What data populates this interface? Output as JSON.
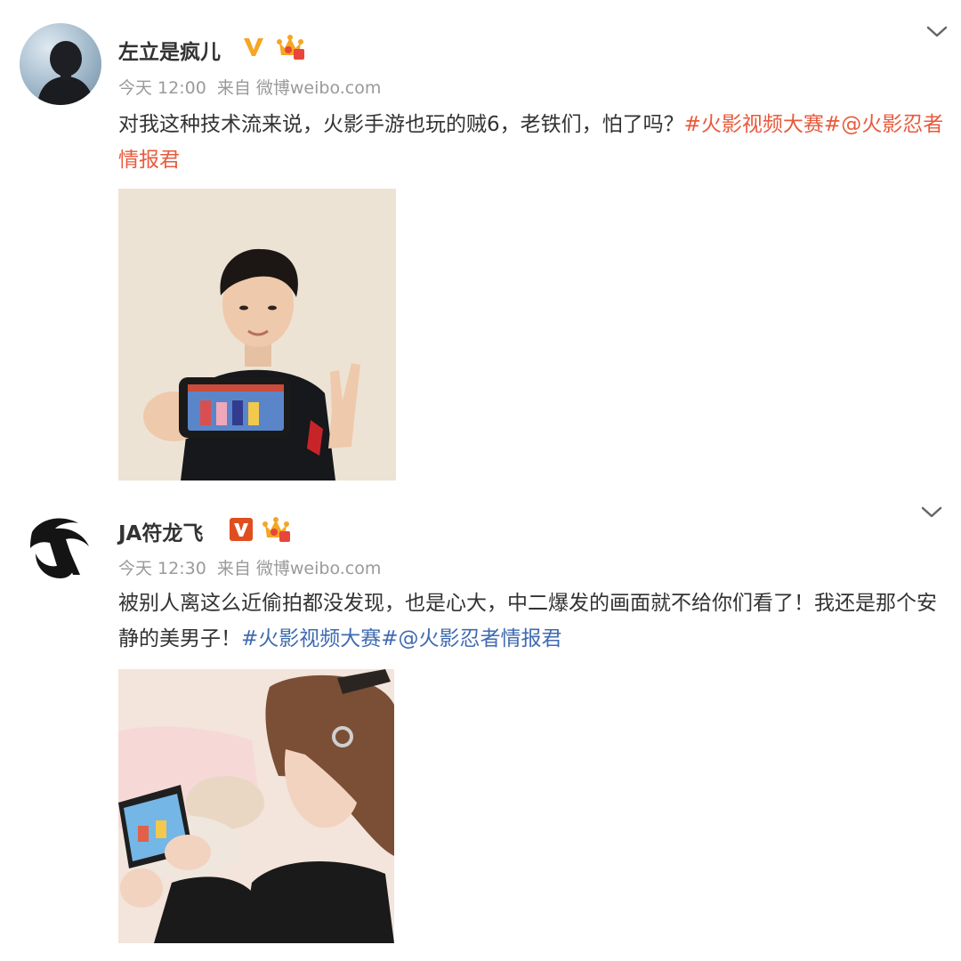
{
  "posts": [
    {
      "username": "左立是疯儿",
      "time": "今天 12:00",
      "source": "来自 微博weibo.com",
      "text_before": "对我这种技术流来说，火影手游也玩的贼6，老铁们，怕了吗？",
      "hashtag": "#火影视频大赛#",
      "mention": "@火影忍者情报君",
      "icons": {
        "avatar": "avatar-photo",
        "verified": "verified-v-icon",
        "crown": "vip-crown-icon",
        "menu": "chevron-down-icon"
      },
      "colors": {
        "link": "#e85a3c",
        "verified": "#f5a623"
      }
    },
    {
      "username": "JA符龙飞",
      "time": "今天 12:30",
      "source": "来自 微博weibo.com",
      "text_before": "被别人离这么近偷拍都没发现，也是心大，中二爆发的画面就不给你们看了！我还是那个安静的美男子！",
      "hashtag": "#火影视频大赛#",
      "mention": "@火影忍者情报君",
      "icons": {
        "avatar": "ja-dragon-logo",
        "verified": "verified-v-icon",
        "crown": "vip-crown-icon",
        "menu": "chevron-down-icon"
      },
      "colors": {
        "link": "#3f6bb0",
        "verified": "#e04e1f"
      }
    }
  ]
}
